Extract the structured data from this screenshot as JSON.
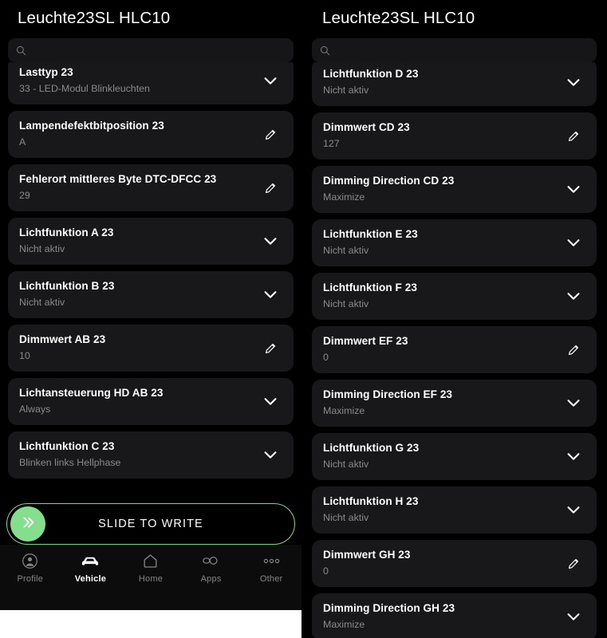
{
  "colors": {
    "background": "#000000",
    "card": "#18181a",
    "search": "#161618",
    "title_text": "#ffffff",
    "value_text": "#8a8a8e",
    "accent_green": "#85dd8e",
    "nav_bar": "#0c0c0d",
    "nav_inactive": "#85858a"
  },
  "left_panel": {
    "title": "Leuchte23SL HLC10",
    "search": {
      "placeholder": "",
      "value": ""
    },
    "items": [
      {
        "title": "Lasttyp 23",
        "value": "33 - LED-Modul Blinkleuchten",
        "action": "chevron-down-icon",
        "clipped": true
      },
      {
        "title": "Lampendefektbitposition 23",
        "value": "A",
        "action": "pencil-icon",
        "clipped": false
      },
      {
        "title": "Fehlerort mittleres Byte DTC-DFCC 23",
        "value": "29",
        "action": "pencil-icon",
        "clipped": false
      },
      {
        "title": "Lichtfunktion A 23",
        "value": "Nicht aktiv",
        "action": "chevron-down-icon",
        "clipped": false
      },
      {
        "title": "Lichtfunktion B 23",
        "value": "Nicht aktiv",
        "action": "chevron-down-icon",
        "clipped": false
      },
      {
        "title": "Dimmwert AB 23",
        "value": "10",
        "action": "pencil-icon",
        "clipped": false
      },
      {
        "title": "Lichtansteuerung HD AB 23",
        "value": "Always",
        "action": "chevron-down-icon",
        "clipped": false
      },
      {
        "title": "Lichtfunktion C 23",
        "value": "Blinken links Hellphase",
        "action": "chevron-down-icon",
        "clipped": false
      }
    ],
    "slide_button": {
      "label": "SLIDE TO WRITE",
      "knob_icon": "double-chevron-right-icon"
    },
    "bottom_nav": [
      {
        "label": "Profile",
        "icon": "profile-icon",
        "active": false
      },
      {
        "label": "Vehicle",
        "icon": "car-icon",
        "active": true
      },
      {
        "label": "Home",
        "icon": "home-icon",
        "active": false
      },
      {
        "label": "Apps",
        "icon": "apps-icon",
        "active": false
      },
      {
        "label": "Other",
        "icon": "ellipsis-icon",
        "active": false
      }
    ]
  },
  "right_panel": {
    "title": "Leuchte23SL HLC10",
    "search": {
      "placeholder": "",
      "value": ""
    },
    "items": [
      {
        "title": "Lichtfunktion D 23",
        "value": "Nicht aktiv",
        "action": "chevron-down-icon",
        "clipped": true
      },
      {
        "title": "Dimmwert CD 23",
        "value": "127",
        "action": "pencil-icon",
        "clipped": false
      },
      {
        "title": "Dimming Direction CD 23",
        "value": "Maximize",
        "action": "chevron-down-icon",
        "clipped": false
      },
      {
        "title": "Lichtfunktion E 23",
        "value": "Nicht aktiv",
        "action": "chevron-down-icon",
        "clipped": false
      },
      {
        "title": "Lichtfunktion F 23",
        "value": "Nicht aktiv",
        "action": "chevron-down-icon",
        "clipped": false
      },
      {
        "title": "Dimmwert EF 23",
        "value": "0",
        "action": "pencil-icon",
        "clipped": false
      },
      {
        "title": "Dimming Direction EF 23",
        "value": "Maximize",
        "action": "chevron-down-icon",
        "clipped": false
      },
      {
        "title": "Lichtfunktion G 23",
        "value": "Nicht aktiv",
        "action": "chevron-down-icon",
        "clipped": false
      },
      {
        "title": "Lichtfunktion H 23",
        "value": "Nicht aktiv",
        "action": "chevron-down-icon",
        "clipped": false
      },
      {
        "title": "Dimmwert GH 23",
        "value": "0",
        "action": "pencil-icon",
        "clipped": false
      },
      {
        "title": "Dimming Direction GH 23",
        "value": "Maximize",
        "action": "chevron-down-icon",
        "clipped": false
      }
    ]
  }
}
